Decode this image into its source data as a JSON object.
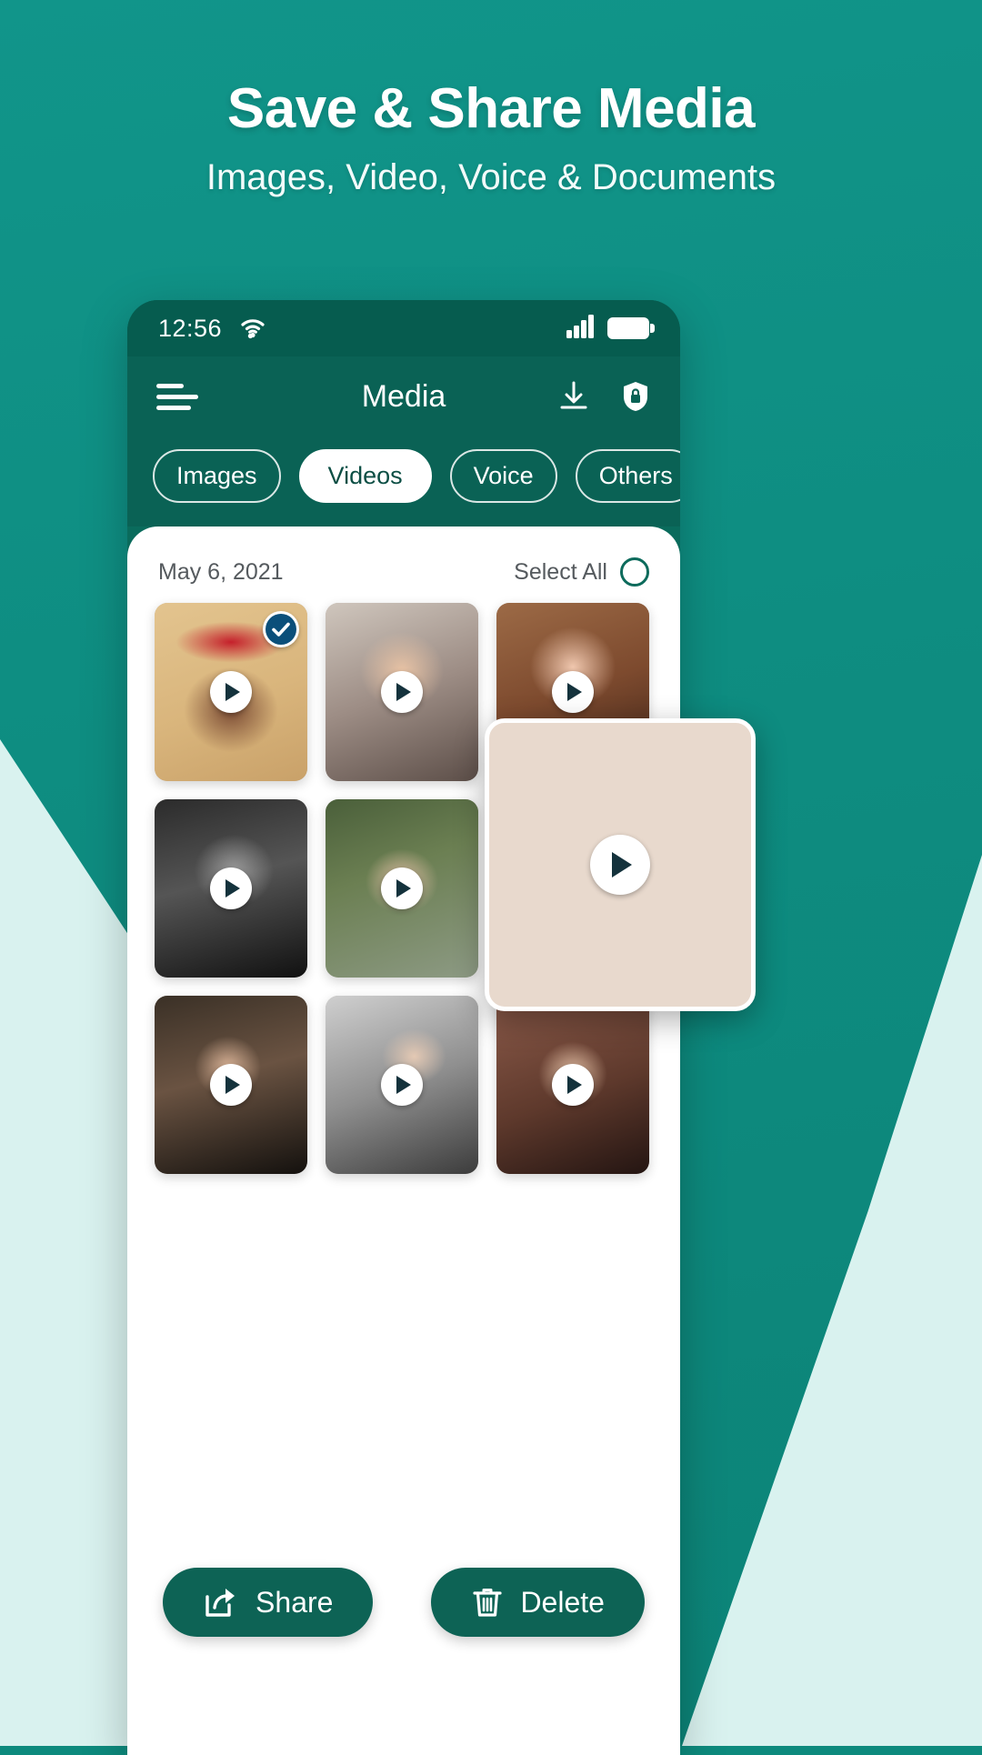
{
  "promo": {
    "title": "Save & Share Media",
    "subtitle": "Images, Video, Voice & Documents"
  },
  "colors": {
    "brand_teal": "#0d8a7d",
    "dark_teal": "#0a6255",
    "accent_mint": "#d9f2ef",
    "button_teal": "#0d6355",
    "sheet_white": "#ffffff"
  },
  "phone": {
    "status_bar": {
      "time": "12:56",
      "wifi_icon": "wifi-icon",
      "signal_icon": "signal-bars-icon",
      "battery_icon": "battery-full-icon"
    },
    "app_bar": {
      "menu_icon": "hamburger-menu-icon",
      "title": "Media",
      "download_icon": "download-icon",
      "lock_icon": "shield-lock-icon"
    },
    "tabs": [
      {
        "label": "Images",
        "active": false
      },
      {
        "label": "Videos",
        "active": true
      },
      {
        "label": "Voice",
        "active": false
      },
      {
        "label": "Others",
        "active": false
      }
    ],
    "sheet": {
      "date": "May 6, 2021",
      "select_all_label": "Select All",
      "select_all_checked": false,
      "items": [
        {
          "id": "v1",
          "selected": true,
          "play_icon": "play-icon"
        },
        {
          "id": "v2",
          "selected": false,
          "play_icon": "play-icon"
        },
        {
          "id": "v3",
          "selected": false,
          "play_icon": "play-icon"
        },
        {
          "id": "v4",
          "selected": false,
          "play_icon": "play-icon"
        },
        {
          "id": "v5",
          "selected": false,
          "play_icon": "play-icon"
        },
        {
          "id": "v6",
          "selected": false,
          "play_icon": "play-icon"
        },
        {
          "id": "v7",
          "selected": false,
          "play_icon": "play-icon"
        },
        {
          "id": "v8",
          "selected": false,
          "play_icon": "play-icon"
        },
        {
          "id": "v9",
          "selected": false,
          "play_icon": "play-icon"
        }
      ]
    },
    "preview_card": {
      "play_icon": "play-icon"
    },
    "actions": {
      "share_label": "Share",
      "share_icon": "share-icon",
      "delete_label": "Delete",
      "delete_icon": "trash-icon"
    }
  }
}
